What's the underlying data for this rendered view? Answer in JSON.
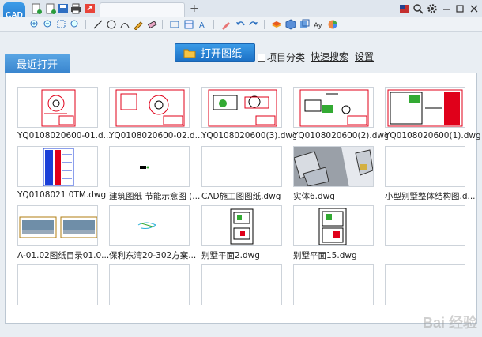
{
  "app": {
    "logo_text": "CAD"
  },
  "tabs": {
    "add": "+"
  },
  "main": {
    "recent_tab": "最近打开",
    "open_button": "打开图纸",
    "project_classify": "项目分类",
    "quick_search": "快速搜索",
    "settings": "设置"
  },
  "files": [
    {
      "name": "YQ0108020600-01.d..."
    },
    {
      "name": "YQ0108020600-02.d..."
    },
    {
      "name": "YQ0108020600(3).dwg"
    },
    {
      "name": "YQ0108020600(2).dwg"
    },
    {
      "name": "YQ0108020600(1).dwg"
    },
    {
      "name": "YQ0108021 0TM.dwg"
    },
    {
      "name": "建筑图纸 节能示意图 (..."
    },
    {
      "name": "CAD施工图图纸.dwg"
    },
    {
      "name": "实体6.dwg"
    },
    {
      "name": "小型别墅整体结构图.d..."
    },
    {
      "name": "A-01.02图纸目录01.0..."
    },
    {
      "name": "保利东湾20-302方案..."
    },
    {
      "name": "别墅平面2.dwg"
    },
    {
      "name": "别墅平面15.dwg"
    }
  ],
  "watermark": "Bai 经验",
  "colors": {
    "accent": "#2a86d8",
    "cad_red": "#e0001a",
    "cad_blue": "#1a3fd8"
  }
}
